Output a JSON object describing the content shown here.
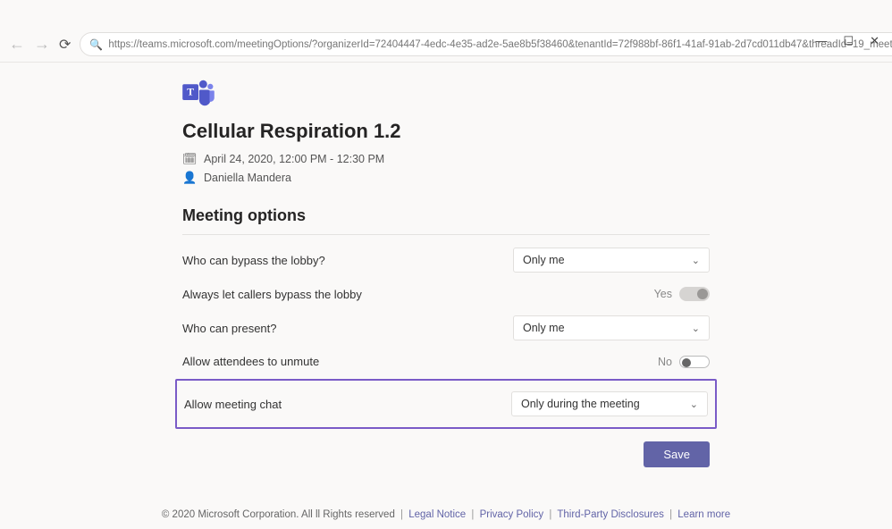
{
  "window": {
    "minimize": "—",
    "maximize": "☐",
    "close": "✕"
  },
  "browser": {
    "url": "https://teams.microsoft.com/meetingOptions/?organizerId=72404447-4edc-4e35-ad2e-5ae8b5f38460&tenantId=72f988bf-86f1-41af-91ab-2d7cd011db47&threadId=19_meetin..."
  },
  "meeting": {
    "title": "Cellular Respiration 1.2",
    "datetime": "April 24, 2020, 12:00 PM - 12:30 PM",
    "organizer": "Daniella Mandera",
    "options_heading": "Meeting options"
  },
  "options": {
    "bypass_lobby": {
      "label": "Who can bypass the lobby?",
      "value": "Only me"
    },
    "callers_bypass": {
      "label": "Always let callers bypass the lobby",
      "value": "Yes"
    },
    "who_present": {
      "label": "Who can present?",
      "value": "Only me"
    },
    "allow_unmute": {
      "label": "Allow attendees to unmute",
      "value": "No"
    },
    "allow_chat": {
      "label": "Allow meeting chat",
      "value": "Only during the meeting"
    }
  },
  "actions": {
    "save": "Save"
  },
  "footer": {
    "copyright": "© 2020 Microsoft Corporation. All ll Rights reserved",
    "legal": "Legal Notice",
    "privacy": "Privacy Policy",
    "third": "Third-Party Disclosures",
    "learn": "Learn more"
  }
}
